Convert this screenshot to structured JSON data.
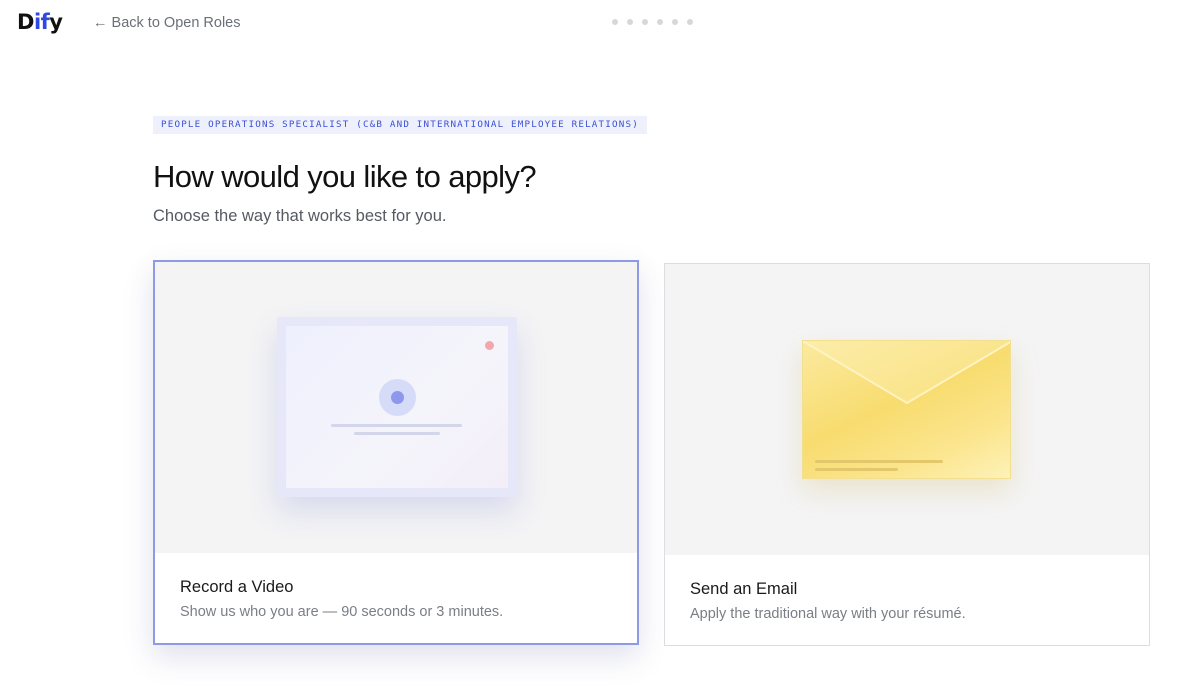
{
  "header": {
    "logo_text_a": "D",
    "logo_text_b": "if",
    "logo_text_c": "y",
    "back_link": "← Back to Open Roles",
    "steps_total": 6
  },
  "role_badge": "PEOPLE OPERATIONS SPECIALIST (C&B AND INTERNATIONAL EMPLOYEE RELATIONS)",
  "title": "How would you like to apply?",
  "subtitle": "Choose the way that works best for you.",
  "options": [
    {
      "title": "Record a Video",
      "description": "Show us who you are — 90 seconds or 3 minutes.",
      "icon": "video-icon",
      "selected": true
    },
    {
      "title": "Send an Email",
      "description": "Apply the traditional way with your résumé.",
      "icon": "envelope-icon",
      "selected": false
    }
  ],
  "colors": {
    "accent": "#2f49e0",
    "selected_border": "#8f9ae6",
    "badge_bg": "#eef0fb",
    "envelope": "#f8dc6f"
  }
}
